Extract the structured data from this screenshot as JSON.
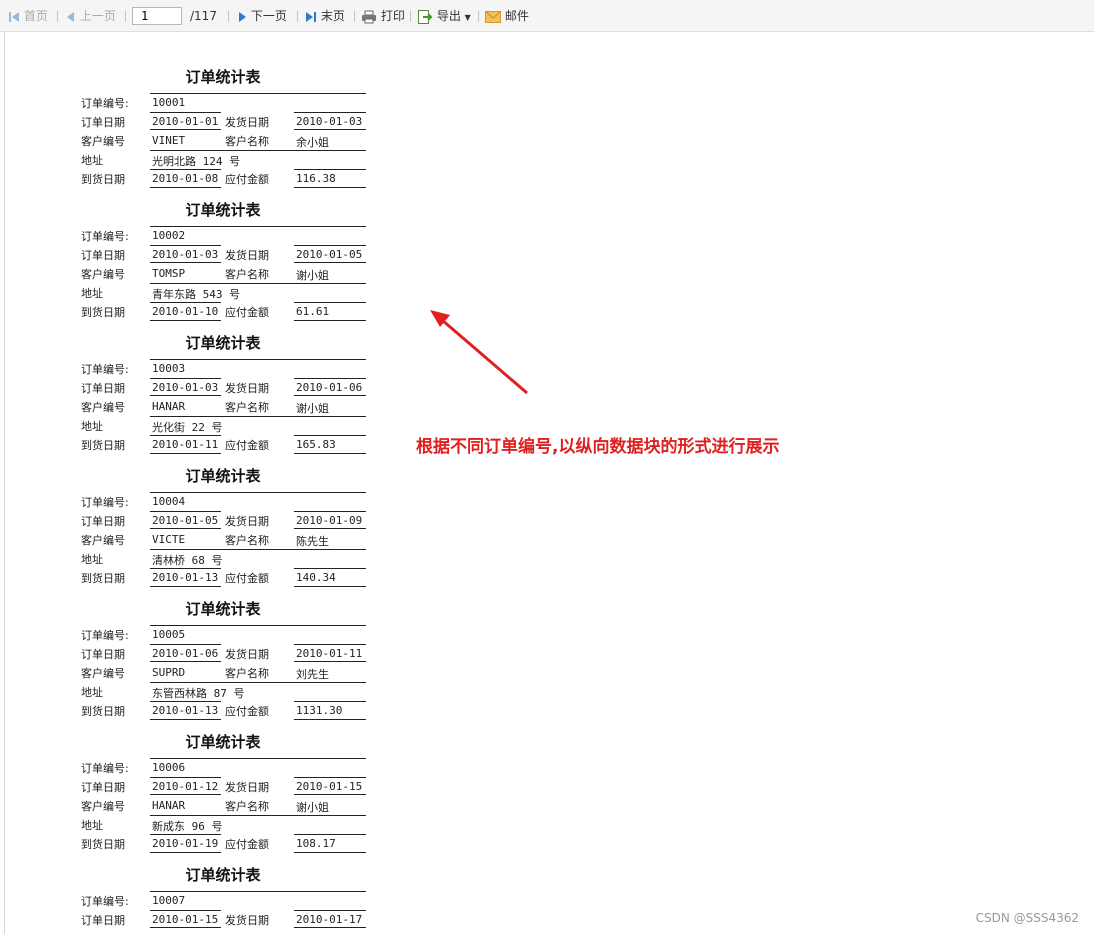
{
  "toolbar": {
    "first": "首页",
    "prev": "上一页",
    "page_value": "1",
    "page_total": "/117",
    "next": "下一页",
    "last": "末页",
    "print": "打印",
    "export": "导出",
    "mail": "邮件"
  },
  "report": {
    "labels": {
      "title": "订单统计表",
      "order_no": "订单编号:",
      "order_date": "订单日期",
      "ship_date": "发货日期",
      "cust_id": "客户编号",
      "cust_name": "客户名称",
      "address": "地址",
      "arrive_date": "到货日期",
      "amount": "应付金额"
    },
    "blocks": [
      {
        "order_no": "10001",
        "order_date": "2010-01-01",
        "ship_date": "2010-01-03",
        "cust_id": "VINET",
        "cust_name": "余小姐",
        "address": "光明北路 124 号",
        "arrive_date": "2010-01-08",
        "amount": "116.38"
      },
      {
        "order_no": "10002",
        "order_date": "2010-01-03",
        "ship_date": "2010-01-05",
        "cust_id": "TOMSP",
        "cust_name": "谢小姐",
        "address": "青年东路 543 号",
        "arrive_date": "2010-01-10",
        "amount": "61.61"
      },
      {
        "order_no": "10003",
        "order_date": "2010-01-03",
        "ship_date": "2010-01-06",
        "cust_id": "HANAR",
        "cust_name": "谢小姐",
        "address": "光化街 22 号",
        "arrive_date": "2010-01-11",
        "amount": "165.83"
      },
      {
        "order_no": "10004",
        "order_date": "2010-01-05",
        "ship_date": "2010-01-09",
        "cust_id": "VICTE",
        "cust_name": "陈先生",
        "address": "清林桥 68 号",
        "arrive_date": "2010-01-13",
        "amount": "140.34"
      },
      {
        "order_no": "10005",
        "order_date": "2010-01-06",
        "ship_date": "2010-01-11",
        "cust_id": "SUPRD",
        "cust_name": "刘先生",
        "address": "东管西林路 87 号",
        "arrive_date": "2010-01-13",
        "amount": "1131.30"
      },
      {
        "order_no": "10006",
        "order_date": "2010-01-12",
        "ship_date": "2010-01-15",
        "cust_id": "HANAR",
        "cust_name": "谢小姐",
        "address": "新成东 96 号",
        "arrive_date": "2010-01-19",
        "amount": "108.17"
      },
      {
        "order_no": "10007",
        "order_date": "2010-01-15",
        "ship_date": "2010-01-17",
        "cust_id": "",
        "cust_name": "",
        "address": "",
        "arrive_date": "",
        "amount": ""
      }
    ]
  },
  "annotation": {
    "text": "根据不同订单编号,以纵向数据块的形式进行展示",
    "color": "#e02020"
  },
  "watermark": "CSDN @SSS4362"
}
